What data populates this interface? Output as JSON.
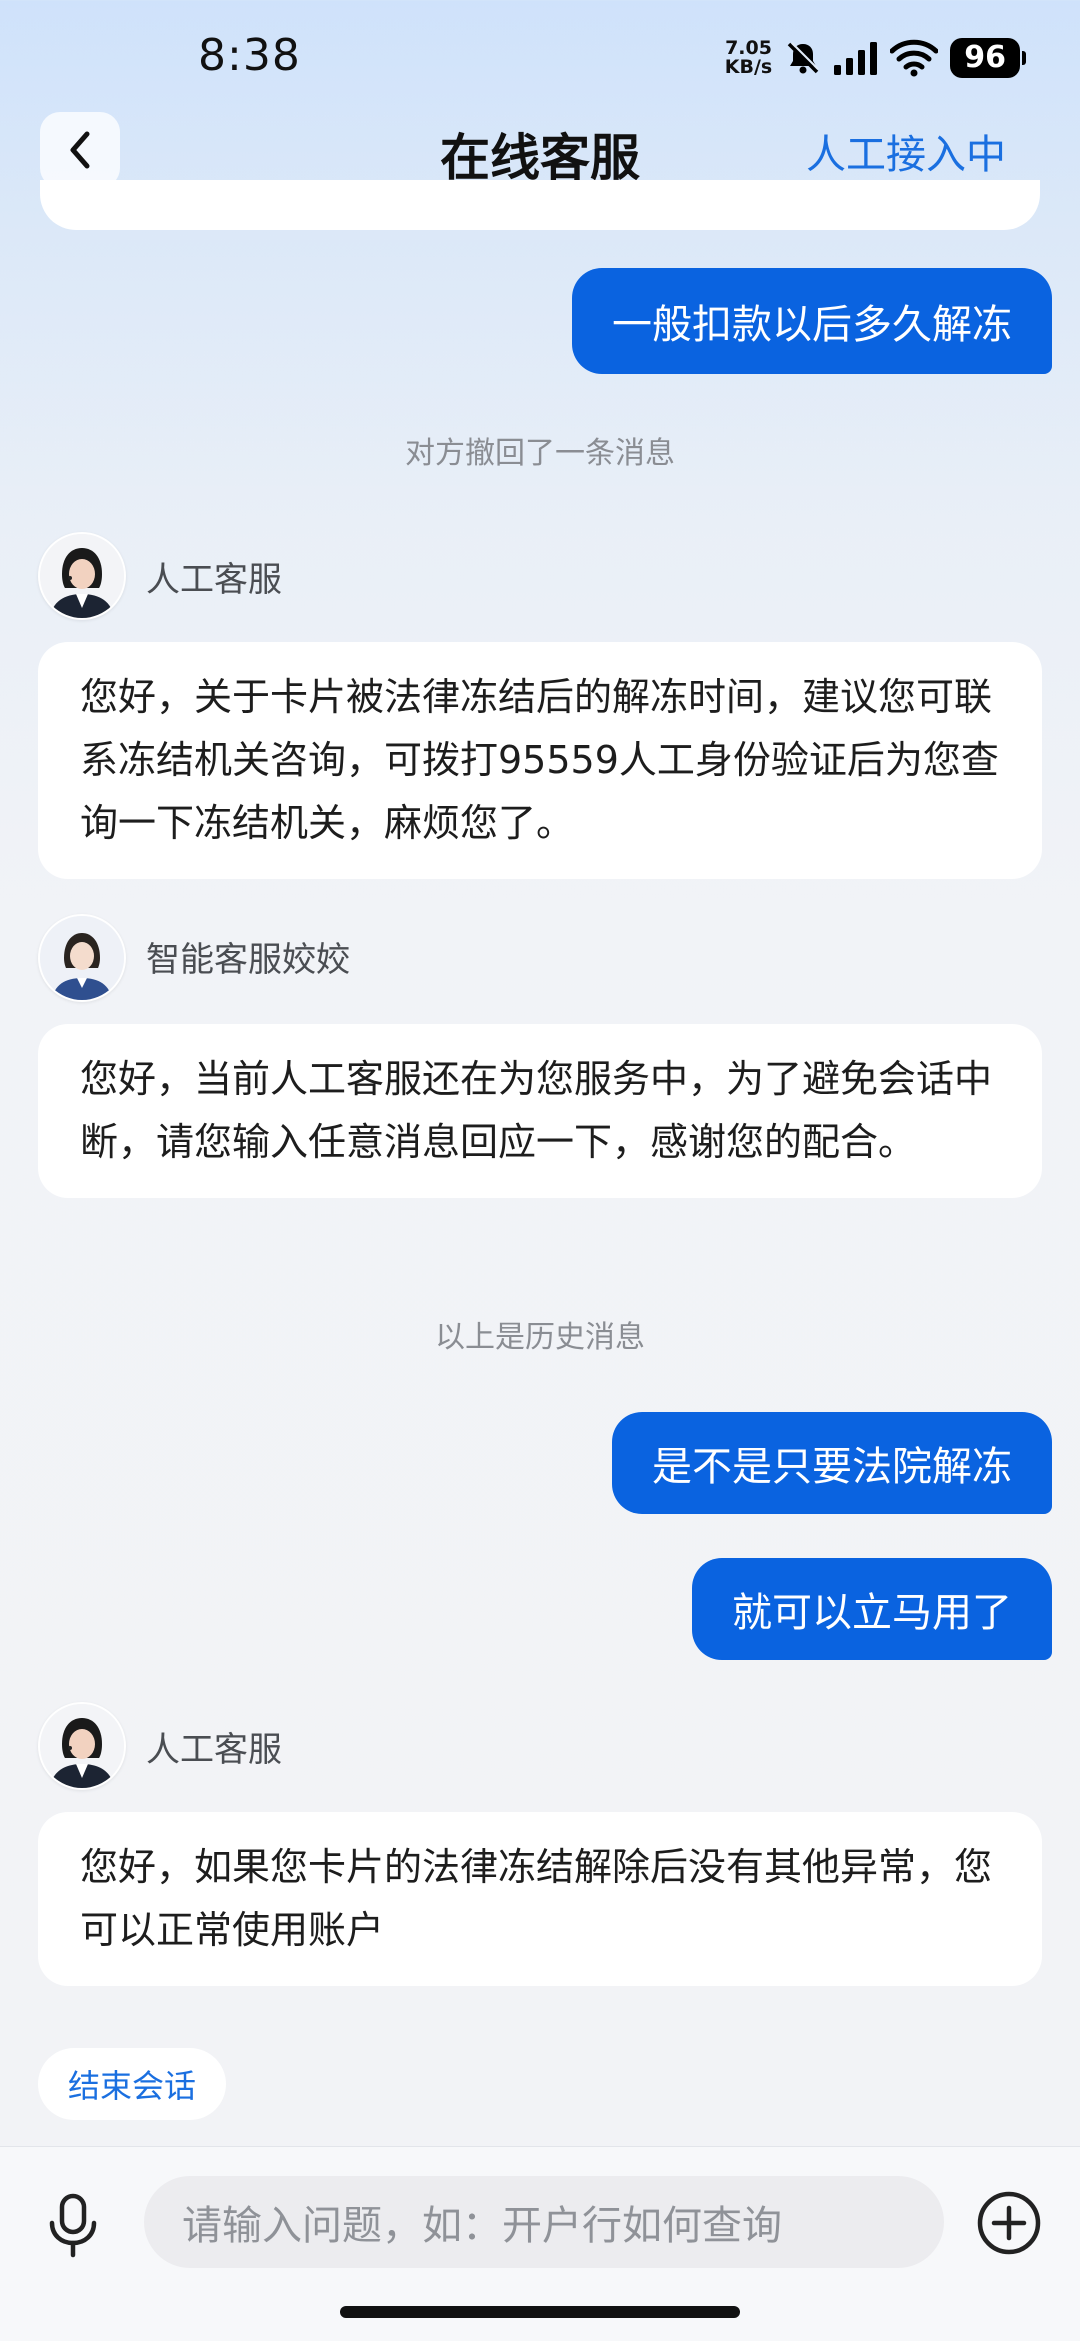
{
  "status_bar": {
    "time": "8:38",
    "net_speed_value": "7.05",
    "net_speed_unit": "KB/s",
    "battery": "96"
  },
  "nav": {
    "title": "在线客服",
    "status": "人工接入中"
  },
  "messages": {
    "out_1": "一般扣款以后多久解冻",
    "notice_recalled": "对方撤回了一条消息",
    "agent_1_name": "人工客服",
    "agent_1_text": "您好，关于卡片被法律冻结后的解冻时间，建议您可联系冻结机关咨询，可拨打95559人工身份验证后为您查询一下冻结机关，麻烦您了。",
    "bot_name": "智能客服姣姣",
    "bot_text": "您好，当前人工客服还在为您服务中，为了避免会话中断，请您输入任意消息回应一下，感谢您的配合。",
    "notice_history": "以上是历史消息",
    "out_2": "是不是只要法院解冻",
    "out_3": "就可以立马用了",
    "agent_2_name": "人工客服",
    "agent_2_text": "您好，如果您卡片的法律冻结解除后没有其他异常，您可以正常使用账户"
  },
  "actions": {
    "end_session": "结束会话"
  },
  "input": {
    "placeholder": "请输入问题，如：开户行如何查询"
  },
  "icons": [
    "back-icon",
    "mute-bell-icon",
    "signal-icon",
    "wifi-icon",
    "battery-icon",
    "microphone-icon",
    "plus-circle-icon",
    "agent-avatar",
    "bot-avatar"
  ],
  "colors": {
    "accent": "#0a63e0",
    "link": "#1a6fe0",
    "bubble_in": "#ffffff"
  }
}
